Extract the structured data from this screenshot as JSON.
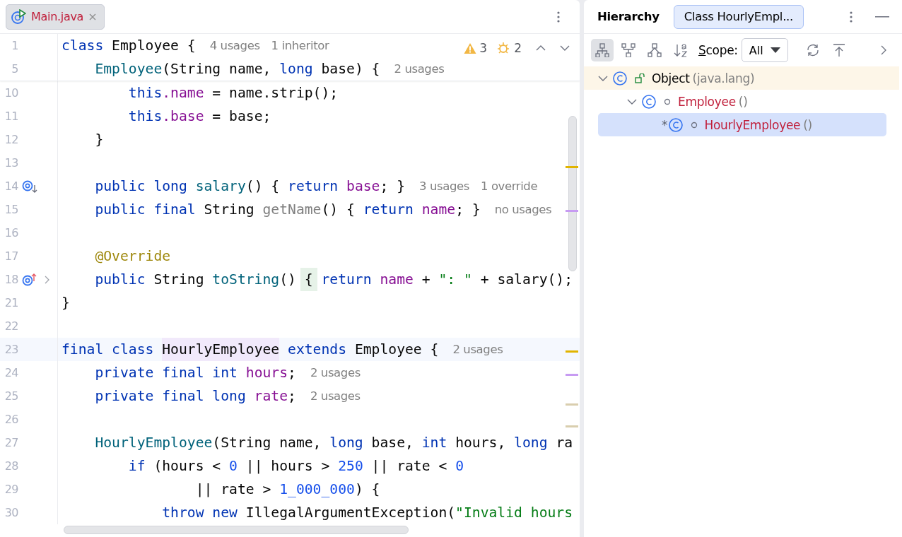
{
  "editor": {
    "tabs": [
      {
        "label": "Main.java",
        "selected": true,
        "closable": true
      }
    ],
    "inspections": {
      "warnings": "3",
      "weak_warnings": "2"
    },
    "sticky_lines": [
      {
        "number": "1",
        "tokens": [
          {
            "t": "class",
            "kind": "kw"
          },
          {
            "t": " Employee {",
            "kind": "plain"
          }
        ],
        "hints": [
          "4 usages",
          "1 inheritor"
        ]
      },
      {
        "number": "5",
        "tokens": [
          {
            "t": "    Employee",
            "kind": "fn"
          },
          {
            "t": "(String name, ",
            "kind": "plain"
          },
          {
            "t": "long",
            "kind": "kw"
          },
          {
            "t": " base) {",
            "kind": "plain"
          }
        ],
        "hints": [
          "2 usages"
        ]
      }
    ],
    "lines": [
      {
        "number": "10",
        "tokens": [
          {
            "t": "        this",
            "kind": "kw"
          },
          {
            "t": ".name",
            "kind": "field"
          },
          {
            "t": " = name.strip();",
            "kind": "plain"
          }
        ],
        "folded": false,
        "current": false
      },
      {
        "number": "11",
        "tokens": [
          {
            "t": "        this",
            "kind": "kw"
          },
          {
            "t": ".base",
            "kind": "field"
          },
          {
            "t": " = base;",
            "kind": "plain"
          }
        ],
        "folded": false,
        "current": false
      },
      {
        "number": "12",
        "tokens": [
          {
            "t": "    }",
            "kind": "plain"
          }
        ],
        "folded": false,
        "current": false
      },
      {
        "number": "13",
        "folded": false,
        "current": false
      },
      {
        "number": "14",
        "gutter": {
          "kind": "implemented"
        },
        "tokens": [
          {
            "t": "    public long",
            "kind": "kw"
          },
          {
            "t": " salary",
            "kind": "fn"
          },
          {
            "t": "() { ",
            "kind": "plain"
          },
          {
            "t": "return",
            "kind": "kw"
          },
          {
            "t": " base",
            "kind": "field"
          },
          {
            "t": "; }",
            "kind": "plain"
          }
        ],
        "hints": [
          "3 usages",
          "1 override"
        ],
        "folded": false,
        "current": false
      },
      {
        "number": "15",
        "tokens": [
          {
            "t": "    public final",
            "kind": "kw"
          },
          {
            "t": " String ",
            "kind": "plain"
          },
          {
            "t": "getName",
            "kind": "unused"
          },
          {
            "t": "() { ",
            "kind": "plain"
          },
          {
            "t": "return",
            "kind": "kw"
          },
          {
            "t": " name",
            "kind": "field"
          },
          {
            "t": "; }",
            "kind": "plain"
          }
        ],
        "hints": [
          "no usages"
        ],
        "folded": false,
        "current": false
      },
      {
        "number": "16",
        "folded": false,
        "current": false
      },
      {
        "number": "17",
        "tokens": [
          {
            "t": "    @Override",
            "kind": "ann"
          }
        ],
        "folded": false,
        "current": false
      },
      {
        "number": "18",
        "gutter": {
          "kind": "overrides"
        },
        "tokens": [
          {
            "t": "    public",
            "kind": "kw"
          },
          {
            "t": " String ",
            "kind": "plain"
          },
          {
            "t": "toString",
            "kind": "fn"
          },
          {
            "t": "() ",
            "kind": "plain"
          },
          {
            "t": "{",
            "kind": "plain",
            "highlight": {
              "kind": "brace"
            }
          },
          {
            "t": " return",
            "kind": "kw"
          },
          {
            "t": " name",
            "kind": "field"
          },
          {
            "t": " + ",
            "kind": "plain"
          },
          {
            "t": "\": \"",
            "kind": "str"
          },
          {
            "t": " + salary();",
            "kind": "plain"
          }
        ],
        "folded": true,
        "current": false
      },
      {
        "number": "21",
        "tokens": [
          {
            "t": "}",
            "kind": "plain"
          }
        ],
        "folded": false,
        "current": false
      },
      {
        "number": "22",
        "folded": false,
        "current": false
      },
      {
        "number": "23",
        "tokens": [
          {
            "t": "final class ",
            "kind": "kw"
          },
          {
            "t": "HourlyEmployee",
            "kind": "plain",
            "highlight": {
              "kind": "usage"
            }
          },
          {
            "t": " extends",
            "kind": "kw"
          },
          {
            "t": " Employee {",
            "kind": "plain"
          }
        ],
        "hints": [
          "2 usages"
        ],
        "folded": false,
        "current": true
      },
      {
        "number": "24",
        "tokens": [
          {
            "t": "    private final int",
            "kind": "kw"
          },
          {
            "t": " hours",
            "kind": "field"
          },
          {
            "t": ";",
            "kind": "plain"
          }
        ],
        "hints": [
          "2 usages"
        ],
        "folded": false,
        "current": false
      },
      {
        "number": "25",
        "tokens": [
          {
            "t": "    private final long",
            "kind": "kw"
          },
          {
            "t": " rate",
            "kind": "field"
          },
          {
            "t": ";",
            "kind": "plain"
          }
        ],
        "hints": [
          "2 usages"
        ],
        "folded": false,
        "current": false
      },
      {
        "number": "26",
        "folded": false,
        "current": false
      },
      {
        "number": "27",
        "tokens": [
          {
            "t": "    HourlyEmployee",
            "kind": "fn"
          },
          {
            "t": "(String name, ",
            "kind": "plain"
          },
          {
            "t": "long",
            "kind": "kw"
          },
          {
            "t": " base, ",
            "kind": "plain"
          },
          {
            "t": "int",
            "kind": "kw"
          },
          {
            "t": " hours, ",
            "kind": "plain"
          },
          {
            "t": "long",
            "kind": "kw"
          },
          {
            "t": " ra",
            "kind": "plain"
          }
        ],
        "folded": false,
        "current": false
      },
      {
        "number": "28",
        "tokens": [
          {
            "t": "        if",
            "kind": "kw"
          },
          {
            "t": " (hours < ",
            "kind": "plain"
          },
          {
            "t": "0",
            "kind": "num"
          },
          {
            "t": " || hours > ",
            "kind": "plain"
          },
          {
            "t": "250",
            "kind": "num"
          },
          {
            "t": " || rate < ",
            "kind": "plain"
          },
          {
            "t": "0",
            "kind": "num"
          }
        ],
        "folded": false,
        "current": false
      },
      {
        "number": "29",
        "tokens": [
          {
            "t": "                || rate > ",
            "kind": "plain"
          },
          {
            "t": "1_000_000",
            "kind": "num"
          },
          {
            "t": ") {",
            "kind": "plain"
          }
        ],
        "folded": false,
        "current": false
      },
      {
        "number": "30",
        "tokens": [
          {
            "t": "            throw new",
            "kind": "kw"
          },
          {
            "t": " IllegalArgumentException(",
            "kind": "plain"
          },
          {
            "t": "\"Invalid hours",
            "kind": "str"
          }
        ],
        "folded": false,
        "current": false
      }
    ]
  },
  "hierarchy": {
    "title": "Hierarchy",
    "tab": {
      "label": "Class HourlyEmpl...",
      "selected": true
    },
    "toolbar": [
      {
        "kind": "type-hierarchy",
        "selected": true
      },
      {
        "kind": "supertypes",
        "selected": false
      },
      {
        "kind": "subtypes",
        "selected": false
      },
      {
        "kind": "sort",
        "selected": false
      }
    ],
    "scope": {
      "label": "Scope:",
      "value": "All"
    },
    "actions": [
      {
        "kind": "refresh"
      },
      {
        "kind": "export"
      },
      {
        "kind": "more"
      }
    ],
    "tree": [
      {
        "name": "Object",
        "detail": "(java.lang)",
        "color": "#000000",
        "kind": "public",
        "base": true,
        "expanded": true,
        "selected": false,
        "children": [
          {
            "name": "Employee",
            "detail": "()",
            "color": "#c01f3b",
            "kind": "package",
            "base": false,
            "expanded": true,
            "selected": false,
            "children": [
              {
                "name": "HourlyEmployee",
                "detail": "()",
                "color": "#c01f3b",
                "kind": "package",
                "base": false,
                "expanded": false,
                "selected": true,
                "marker": "*"
              }
            ]
          }
        ]
      }
    ]
  }
}
